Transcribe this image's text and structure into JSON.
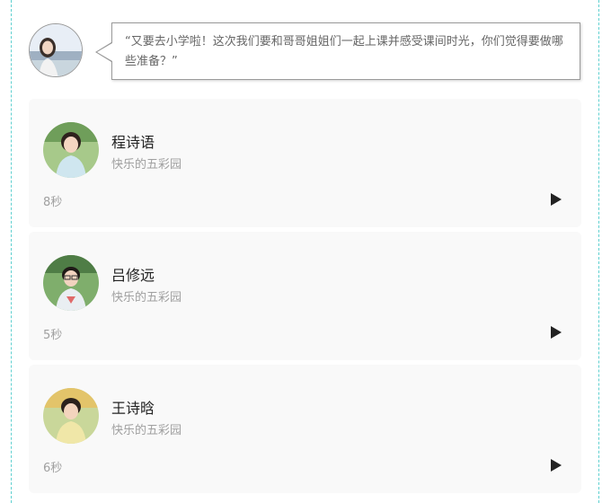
{
  "prompt": {
    "text": "“又要去小学啦！这次我们要和哥哥姐姐们一起上课并感受课间时光，你们觉得要做哪些准备？”"
  },
  "answers": [
    {
      "name": "程诗语",
      "school": "快乐的五彩园",
      "duration": "8秒",
      "avatar_icon": "girl-photo-avatar-icon",
      "shirt_color": "#cfe6ef"
    },
    {
      "name": "吕修远",
      "school": "快乐的五彩园",
      "duration": "5秒",
      "avatar_icon": "boy-photo-avatar-icon",
      "shirt_color": "#e9eef2"
    },
    {
      "name": "王诗晗",
      "school": "快乐的五彩园",
      "duration": "6秒",
      "avatar_icon": "girl-photo-avatar-icon",
      "shirt_color": "#f0e7a8"
    }
  ],
  "colors": {
    "frame_dash": "#5fd0d0",
    "card_bg": "#f9f9f9",
    "muted_text": "#a0a0a0",
    "play_icon": "#222222"
  }
}
